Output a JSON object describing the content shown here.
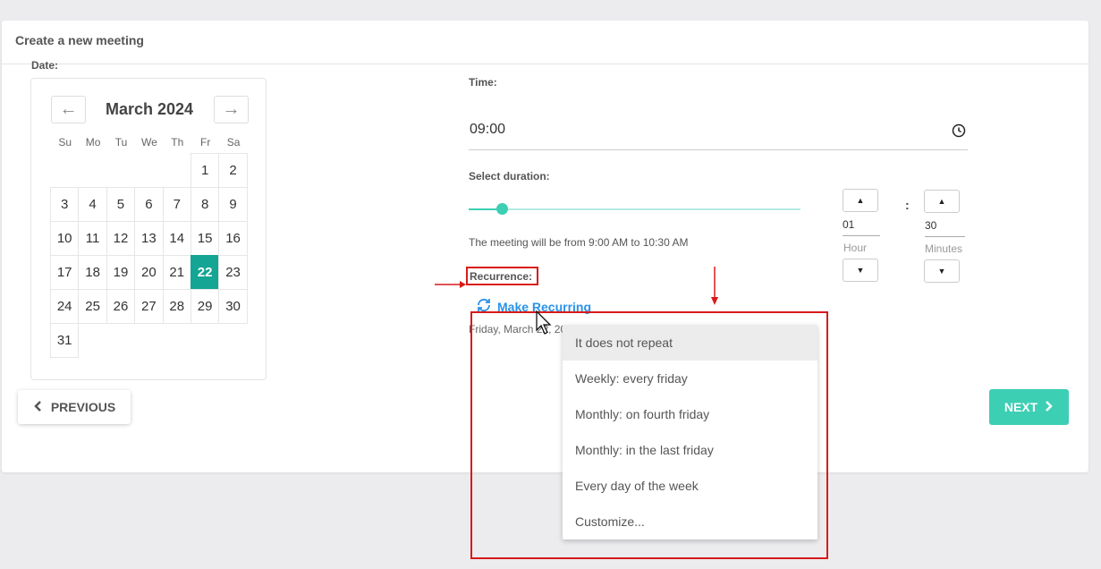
{
  "header": {
    "title": "Create a new meeting"
  },
  "date": {
    "label": "Date:",
    "month_title": "March 2024",
    "weekdays": [
      "Su",
      "Mo",
      "Tu",
      "We",
      "Th",
      "Fr",
      "Sa"
    ],
    "days": [
      [
        "",
        "",
        "",
        "",
        "",
        "1",
        "2"
      ],
      [
        "3",
        "4",
        "5",
        "6",
        "7",
        "8",
        "9"
      ],
      [
        "10",
        "11",
        "12",
        "13",
        "14",
        "15",
        "16"
      ],
      [
        "17",
        "18",
        "19",
        "20",
        "21",
        "22",
        "23"
      ],
      [
        "24",
        "25",
        "26",
        "27",
        "28",
        "29",
        "30"
      ],
      [
        "31",
        "",
        "",
        "",
        "",
        "",
        ""
      ]
    ],
    "selected_day": "22",
    "prev_icon": "arrow-left-icon",
    "next_icon": "arrow-right-icon"
  },
  "time": {
    "label": "Time:",
    "value": "09:00"
  },
  "duration": {
    "label": "Select duration:",
    "slider_fraction": 0.1,
    "note": "The meeting will be from 9:00 AM to 10:30 AM",
    "hours_value": "01",
    "hours_label": "Hour",
    "minutes_value": "30",
    "minutes_label": "Minutes",
    "separator": ":"
  },
  "recurrence": {
    "label": "Recurrence:",
    "make_recurring": "Make Recurring",
    "date_text": "Friday, March 22, 2024",
    "menu": [
      "It does not repeat",
      "Weekly: every friday",
      "Monthly: on fourth friday",
      "Monthly: in the last friday",
      "Every day of the week",
      "Customize..."
    ],
    "active_index": 0
  },
  "buttons": {
    "previous": "PREVIOUS",
    "next": "NEXT"
  },
  "colors": {
    "accent": "#3ccfb4",
    "selected_day": "#14a594",
    "link": "#2a93e8",
    "annotation": "#d91a1a"
  }
}
